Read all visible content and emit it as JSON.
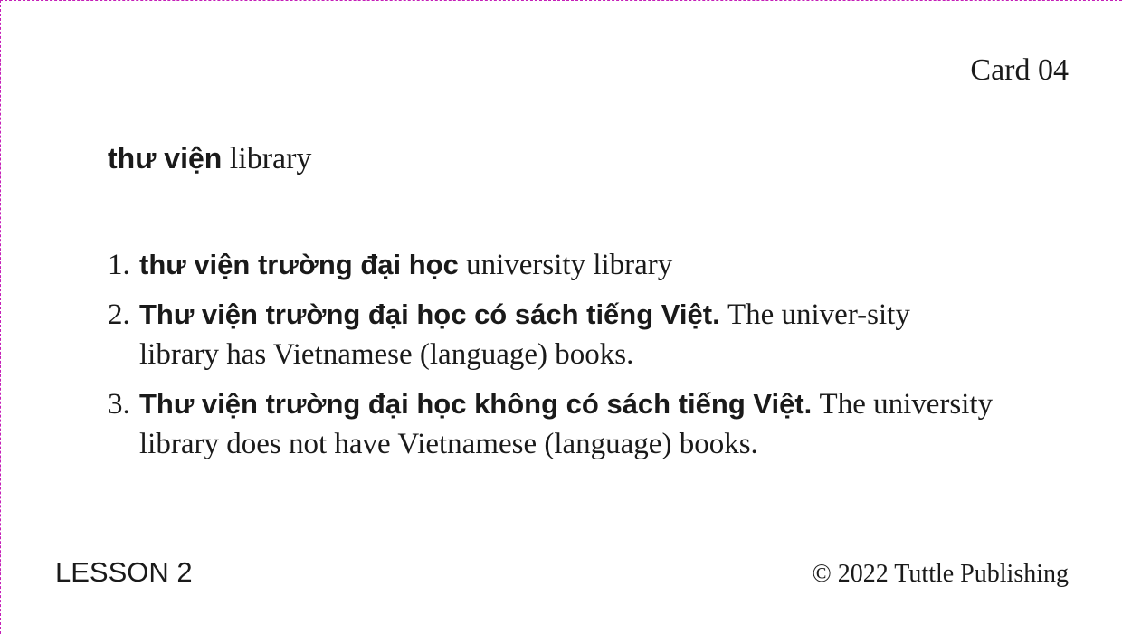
{
  "card": {
    "number_label": "Card 04",
    "border_color": "#c51fb8"
  },
  "headword": {
    "vietnamese": "thư viện",
    "english": "library"
  },
  "examples": [
    {
      "number": "1.",
      "vietnamese": "thư viện trường đại học",
      "english": "university library"
    },
    {
      "number": "2.",
      "vietnamese": "Thư viện trường đại học có sách tiếng Việt.",
      "english": "The univer-sity library has Vietnamese (language) books."
    },
    {
      "number": "3.",
      "vietnamese": "Thư viện trường đại học không có sách tiếng Việt.",
      "english": "The university library does not have Vietnamese (language) books."
    }
  ],
  "footer": {
    "lesson": "LESSON 2",
    "copyright": "© 2022 Tuttle Publishing"
  }
}
